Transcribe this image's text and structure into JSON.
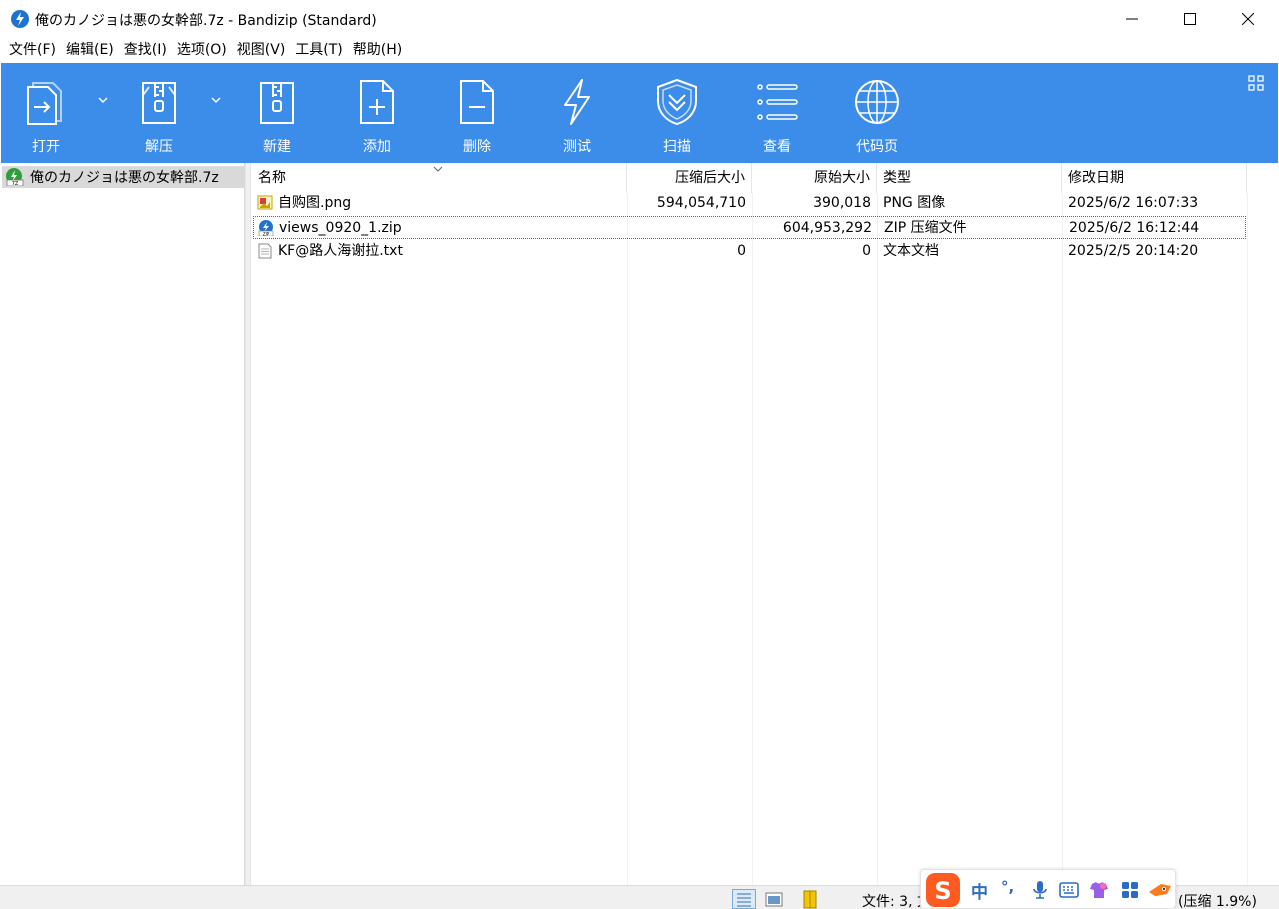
{
  "window": {
    "title": "俺のカノジョは悪の女幹部.7z - Bandizip (Standard)"
  },
  "menu": [
    "文件(F)",
    "编辑(E)",
    "查找(I)",
    "选项(O)",
    "视图(V)",
    "工具(T)",
    "帮助(H)"
  ],
  "toolbar": {
    "open": "打开",
    "extract": "解压",
    "new": "新建",
    "add": "添加",
    "delete": "删除",
    "test": "测试",
    "scan": "扫描",
    "view": "查看",
    "codepage": "代码页"
  },
  "tree": {
    "root": "俺のカノジョは悪の女幹部.7z"
  },
  "columns": {
    "name": "名称",
    "packed": "压缩后大小",
    "size": "原始大小",
    "type": "类型",
    "modified": "修改日期"
  },
  "files": [
    {
      "name": "自购图.png",
      "packed": "594,054,710",
      "size": "390,018",
      "type": "PNG 图像",
      "modified": "2025/6/2 16:07:33"
    },
    {
      "name": "views_0920_1.zip",
      "packed": "",
      "size": "604,953,292",
      "type": "ZIP 压缩文件",
      "modified": "2025/6/2 16:12:44"
    },
    {
      "name": "KF@路人海谢拉.txt",
      "packed": "0",
      "size": "0",
      "type": "文本文档",
      "modified": "2025/2/5 20:14:20"
    }
  ],
  "status": {
    "text": "文件: 3, 文",
    "tail": "(压缩 1.9%)"
  },
  "ime": {
    "lang": "中",
    "punct": "°,"
  },
  "colors": {
    "toolbar": "#3c8ce9",
    "accent": "#1e73d2"
  }
}
